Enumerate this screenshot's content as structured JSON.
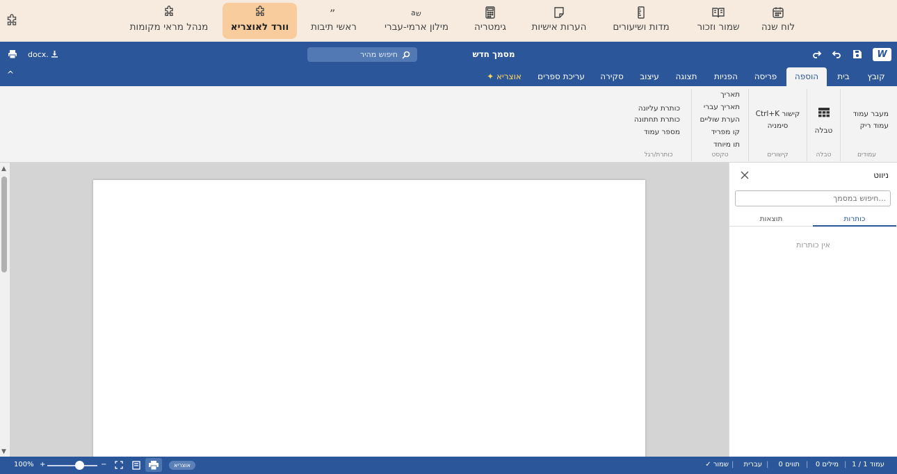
{
  "app_tabs": [
    {
      "label": "לוח שנה",
      "icon": "calendar-icon"
    },
    {
      "label": "שמור וזכור",
      "icon": "book-icon"
    },
    {
      "label": "מדות ושיעורים",
      "icon": "ruler-icon"
    },
    {
      "label": "הערות אישיות",
      "icon": "note-icon"
    },
    {
      "label": "גימטריה",
      "icon": "calculator-icon"
    },
    {
      "label": "מילון ארמי-עברי",
      "icon": "translate-icon"
    },
    {
      "label": "ראשי תיבות",
      "icon": "quote-icon"
    },
    {
      "label": "וורד לאוצריא",
      "icon": "puzzle-icon",
      "active": true
    },
    {
      "label": "מנהל מראי מקומות",
      "icon": "puzzle-icon"
    }
  ],
  "titlebar": {
    "logo": "W",
    "title": "מסמך חדש",
    "search_placeholder": "חיפוש מהיר",
    "docx": "docx."
  },
  "ribbon_tabs": [
    "קובץ",
    "בית",
    "הוספה",
    "פריסה",
    "הפניות",
    "תצוגה",
    "עיצוב",
    "סקירה",
    "עריכת ספרים",
    "✦ אוצריא"
  ],
  "active_ribbon_tab": "הוספה",
  "ribbon": {
    "pages": {
      "name": "עמודים",
      "items": [
        "מעבר עמוד",
        "עמוד ריק"
      ]
    },
    "table": {
      "name": "טבלה",
      "label": "טבלה"
    },
    "links": {
      "name": "קישורים",
      "items": [
        "קישור Ctrl+K",
        "סימניה"
      ]
    },
    "text": {
      "name": "טקסט",
      "items": [
        "תאריך",
        "תאריך עברי",
        "הערת שוליים",
        "קו מפריד",
        "תו מיוחד"
      ]
    },
    "header_footer": {
      "name": "כותרת/רגל",
      "items": [
        "כותרת עליונה",
        "כותרת תחתונה",
        "מספר עמוד"
      ]
    }
  },
  "nav_pane": {
    "title": "ניווט",
    "search_placeholder": "חיפוש במסמך...",
    "tabs": [
      "כותרות",
      "תוצאות"
    ],
    "empty": "אין כותרות"
  },
  "status": {
    "page": "עמוד 1 / 1",
    "words": "0 מילים",
    "chars": "0 תווים",
    "language": "עברית",
    "saved": "✓ שמור",
    "pill": "אוצריא",
    "zoom": "100%",
    "zoom_fraction": 0.6
  },
  "colors": {
    "primary": "#2b579a",
    "appbar": "#f7ebdf",
    "active_tab": "#f8cc9c",
    "accent": "#ffd75e"
  }
}
